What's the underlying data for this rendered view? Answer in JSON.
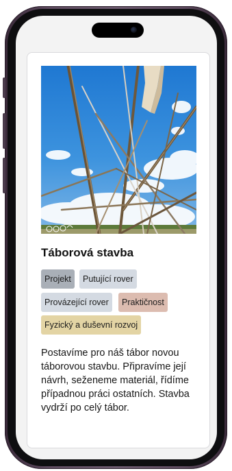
{
  "card": {
    "title": "Táborová stavba",
    "tags": [
      {
        "label": "Projekt",
        "color": "#a9afb7"
      },
      {
        "label": "Putující rover",
        "color": "#d4dae2"
      },
      {
        "label": "Provázející rover",
        "color": "#d4dae2"
      },
      {
        "label": "Praktičnost",
        "color": "#dcbcb0"
      },
      {
        "label": "Fyzický a duševní rozvoj",
        "color": "#e3d4a4"
      }
    ],
    "description": "Postavíme pro náš tábor novou táborovou stavbu. Připravíme její návrh, seženeme materiál, řídíme případnou práci ostatních. Stavba vydrží po celý tábor."
  },
  "colors": {
    "frame": "#5d4a5e",
    "screen_bg": "#f3f3f3",
    "card_bg": "#ffffff",
    "sky": "#2f86d8"
  },
  "icons": {
    "camera": "front-camera-icon"
  }
}
